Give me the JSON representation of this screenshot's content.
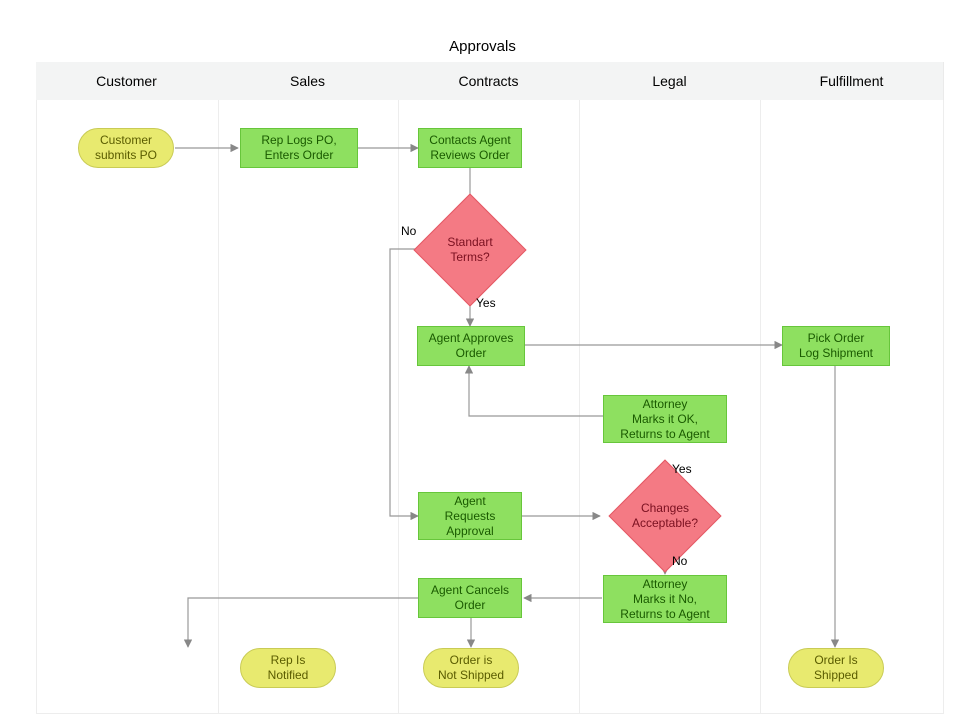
{
  "title": "Approvals",
  "lanes": {
    "customer": "Customer",
    "sales": "Sales",
    "contracts": "Contracts",
    "legal": "Legal",
    "fulfillment": "Fulfillment"
  },
  "nodes": {
    "customer_submits_po": "Customer\nsubmits PO",
    "rep_logs_po": "Rep Logs PO,\nEnters Order",
    "reviews_order": "Contacts Agent\nReviews Order",
    "standard_terms": "Standart Terms?",
    "agent_approves": "Agent Approves\nOrder",
    "agent_requests": "Agent\nRequests\nApproval",
    "changes_acceptable": "Changes\nAcceptable?",
    "attorney_ok": "Attorney\nMarks it OK,\nReturns to Agent",
    "attorney_no": "Attorney\nMarks it No,\nReturns to Agent",
    "agent_cancels": "Agent Cancels\nOrder",
    "rep_notified": "Rep Is\nNotified",
    "not_shipped": "Order is\nNot Shipped",
    "pick_order": "Pick Order\nLog Shipment",
    "shipped": "Order Is\nShipped"
  },
  "edge_labels": {
    "no1": "No",
    "yes1": "Yes",
    "yes2": "Yes",
    "no2": "No"
  }
}
